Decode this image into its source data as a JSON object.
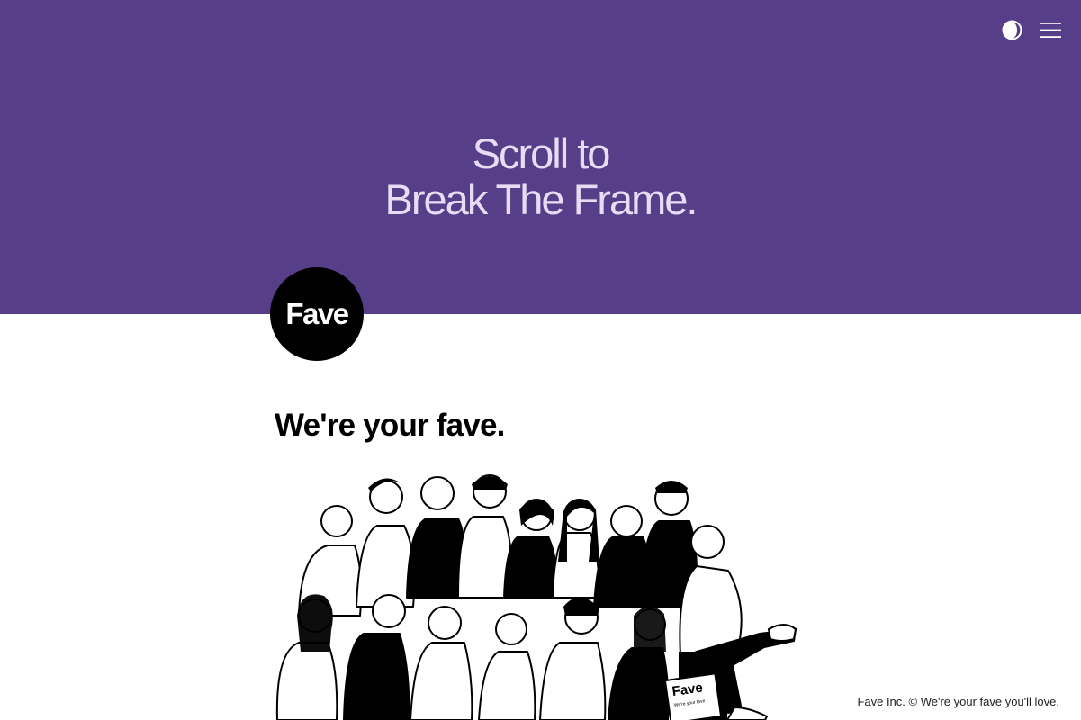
{
  "hero": {
    "line1": "Scroll to",
    "line2": "Break The Frame."
  },
  "header": {
    "theme_icon": "half-moon-contrast-icon",
    "menu_icon": "hamburger-menu-icon"
  },
  "logo": {
    "text": "Fave"
  },
  "section": {
    "heading": "We're your fave."
  },
  "illustration": {
    "sign_title": "Fave",
    "sign_subtitle": "We're your fave"
  },
  "footer": {
    "text": "Fave Inc. © We're your fave you'll love."
  },
  "colors": {
    "hero_bg": "#573e89",
    "hero_text": "#e8dcf5",
    "page_bg": "#ffffff",
    "ink": "#000000"
  }
}
